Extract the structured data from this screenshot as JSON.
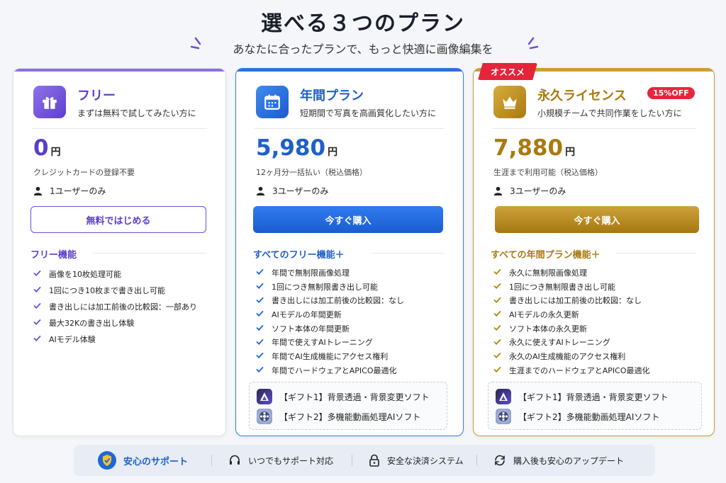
{
  "header": {
    "title": "選べる３つのプラン",
    "subtitle": "あなたに合ったプランで、もっと快適に画像編集を"
  },
  "colors": {
    "free_accent": "#6c4fd6",
    "annual_accent": "#1f66d9",
    "perpetual_accent": "#b8860b",
    "badge_red": "#e5243b"
  },
  "plans": {
    "free": {
      "icon": "gift-icon",
      "name": "フリー",
      "desc": "まずは無料で試してみたい方に",
      "price": "0",
      "currency": "円",
      "price_note": "クレジットカードの登録不要",
      "users": "1ユーザーのみ",
      "cta": "無料ではじめる",
      "section_title": "フリー機能",
      "features": [
        "画像を10枚処理可能",
        "1回につき10枚まで書き出し可能",
        "書き出しには加工前後の比較図：一部あり",
        "最大32Kの書き出し体験",
        "AIモデル体験"
      ]
    },
    "annual": {
      "icon": "calendar-icon",
      "name": "年間プラン",
      "desc": "短期間で写真を高画質化したい方に",
      "price": "5,980",
      "currency": "円",
      "price_note": "12ヶ月分一括払い（税込価格）",
      "users": "3ユーザーのみ",
      "cta": "今すぐ購入",
      "section_title": "すべてのフリー機能＋",
      "features": [
        "年間で無制限画像処理",
        "1回につき無制限書き出し可能",
        "書き出しには加工前後の比較図：なし",
        "AIモデルの年間更新",
        "ソフト本体の年間更新",
        "年間で使えすAIトレーニング",
        "年間でAI生成機能にアクセス権利",
        "年間でハードウェアとAPICO最適化"
      ],
      "gifts": [
        "【ギフト1】背景透過・背景変更ソフト",
        "【ギフト2】多機能動画処理AIソフト"
      ]
    },
    "perpetual": {
      "icon": "crown-icon",
      "name": "永久ライセンス",
      "badge": "15%OFF",
      "ribbon": "オススメ",
      "desc": "小規模チームで共同作業をしたい方に",
      "price": "7,880",
      "currency": "円",
      "price_note": "生涯まで利用可能（税込価格）",
      "users": "3ユーザーのみ",
      "cta": "今すぐ購入",
      "section_title": "すべての年間プラン機能＋",
      "features": [
        "永久に無制限画像処理",
        "1回につき無制限書き出し可能",
        "書き出しには加工前後の比較図：なし",
        "AIモデルの永久更新",
        "ソフト本体の永久更新",
        "永久に使えすAIトレーニング",
        "永久のAI生成機能のアクセス権利",
        "生涯までのハードウェアとAPICO最適化"
      ],
      "gifts": [
        "【ギフト1】背景透過・背景変更ソフト",
        "【ギフト2】多機能動画処理AIソフト"
      ]
    }
  },
  "support": {
    "main": "安心のサポート",
    "items": [
      "いつでもサポート対応",
      "安全な決済システム",
      "購入後も安心のアップデート"
    ]
  }
}
